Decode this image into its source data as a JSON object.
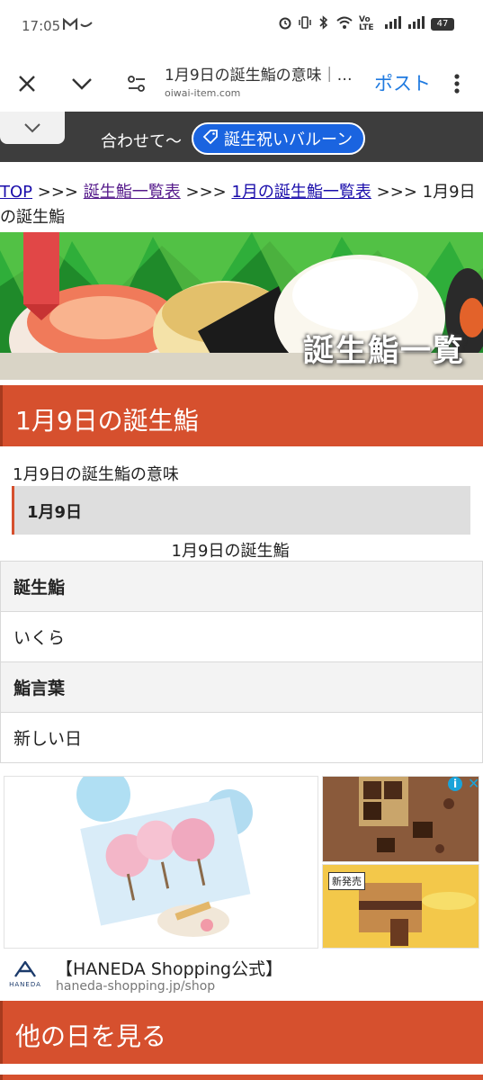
{
  "status_bar": {
    "time": "17:05",
    "mail_icon": "gmail-icon",
    "indicators": [
      "alarm-icon",
      "vibrate-icon",
      "bluetooth-icon",
      "wifi-icon"
    ],
    "network_label": "Vo LTE",
    "battery": "47"
  },
  "browser": {
    "page_title": "1月9日の誕生鮨の意味｜…",
    "url": "oiwai-item.com",
    "post_label": "ポスト"
  },
  "banner": {
    "text": "合わせて～",
    "cta": "誕生祝いバルーン"
  },
  "breadcrumb": {
    "top": "TOP",
    "sep": ">>>",
    "list": "誕生鮨一覧表",
    "month": "1月の誕生鮨一覧表",
    "current": "1月9日の誕生鮨"
  },
  "hero": {
    "label": "誕生鮨一覧"
  },
  "section": {
    "heading": "1月9日の誕生鮨",
    "meaning_title": "1月9日の誕生鮨の意味",
    "date_box": "1月9日",
    "table_caption": "1月9日の誕生鮨",
    "rows": [
      {
        "label": "誕生鮨",
        "value": "いくら"
      },
      {
        "label": "鮨言葉",
        "value": "新しい日"
      }
    ]
  },
  "ad": {
    "badge": "新発売",
    "headline": "【HANEDA Shopping公式】",
    "domain": "haneda-shopping.jp/shop",
    "brand": "HANEDA"
  },
  "other_days": {
    "heading": "他の日を見る"
  },
  "colors": {
    "accent": "#d6502e",
    "link": "#1a0dab",
    "banner_pill": "#1a64e0"
  }
}
